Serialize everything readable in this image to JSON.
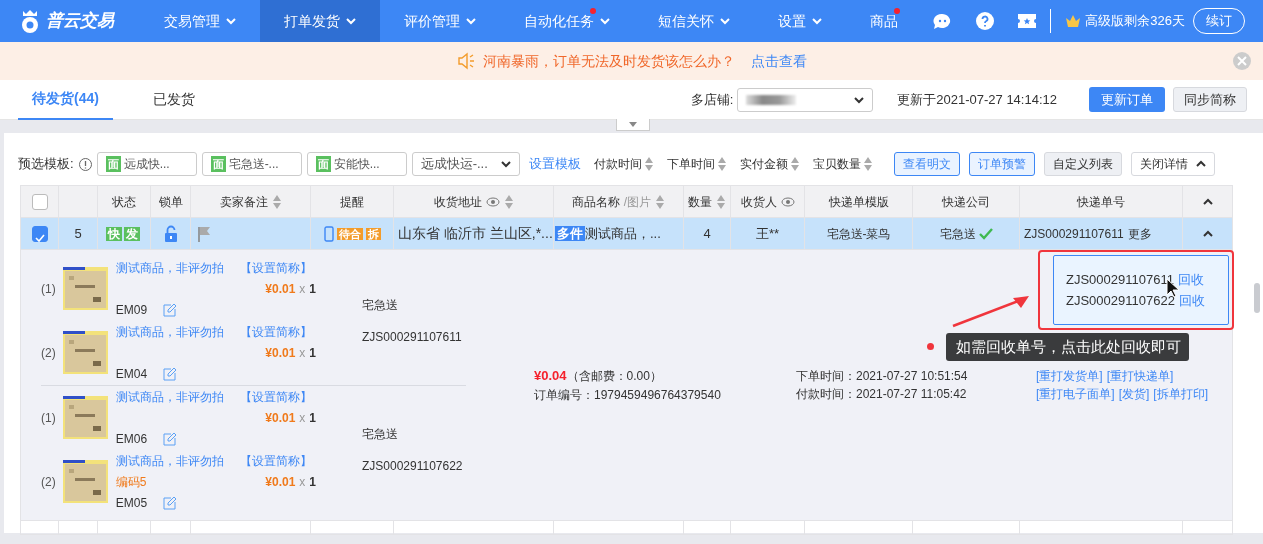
{
  "nav": {
    "logo": "普云交易",
    "menu": [
      {
        "label": "交易管理",
        "selected": false,
        "dropdown": true,
        "dot": false
      },
      {
        "label": "打单发货",
        "selected": true,
        "dropdown": true,
        "dot": false
      },
      {
        "label": "评价管理",
        "selected": false,
        "dropdown": true,
        "dot": false
      },
      {
        "label": "自动化任务",
        "selected": false,
        "dropdown": true,
        "dot": true
      },
      {
        "label": "短信关怀",
        "selected": false,
        "dropdown": true,
        "dot": false
      },
      {
        "label": "设置",
        "selected": false,
        "dropdown": true,
        "dot": false
      },
      {
        "label": "商品",
        "selected": false,
        "dropdown": false,
        "dot": true
      }
    ],
    "plan": "高级版剩余326天",
    "renew": "续订"
  },
  "notice": {
    "text": "河南暴雨，订单无法及时发货该怎么办？",
    "link": "点击查看"
  },
  "tabs": [
    {
      "label": "待发货(44)",
      "selected": true
    },
    {
      "label": "已发货",
      "selected": false
    }
  ],
  "store_label": "多店铺:",
  "updated": "更新于2021-07-27 14:14:12",
  "top_buttons": [
    {
      "label": "更新订单",
      "kind": "primary"
    },
    {
      "label": "同步简称",
      "kind": "plain"
    }
  ],
  "toolbar": {
    "label": "预选模板:",
    "templates": [
      {
        "tag": "面",
        "label": "远成快..."
      },
      {
        "tag": "面",
        "label": "宅急送-..."
      },
      {
        "tag": "面",
        "label": "安能快..."
      }
    ],
    "template_select": "远成快运-...",
    "settings_link": "设置模板",
    "sorts": [
      "付款时间",
      "下单时间",
      "实付金额",
      "宝贝数量"
    ],
    "buttons": [
      {
        "label": "查看明文",
        "kind": "outline"
      },
      {
        "label": "订单预警",
        "kind": "outline"
      },
      {
        "label": "自定义列表",
        "kind": "plain"
      },
      {
        "label": "关闭详情",
        "kind": "toggle"
      }
    ]
  },
  "table": {
    "header_checked": false,
    "columns": [
      {
        "label": "状态",
        "sortable": false,
        "eye": false
      },
      {
        "label": "锁单",
        "sortable": false,
        "eye": false
      },
      {
        "label": "卖家备注",
        "sortable": true,
        "eye": false
      },
      {
        "label": "提醒",
        "sortable": false,
        "eye": false
      },
      {
        "label": "收货地址",
        "sortable": true,
        "eye": true
      },
      {
        "label": "商品名称",
        "sub": "/图片",
        "sortable": true,
        "eye": false
      },
      {
        "label": "数量",
        "sortable": true,
        "eye": false
      },
      {
        "label": "收货人",
        "sortable": false,
        "eye": true
      },
      {
        "label": "快递单模版",
        "sortable": false,
        "eye": false
      },
      {
        "label": "快递公司",
        "sortable": false,
        "eye": false
      },
      {
        "label": "快递单号",
        "sortable": false,
        "eye": false
      }
    ],
    "rows": [
      {
        "selected": true,
        "index": "5",
        "status_tags": [
          "快",
          "发"
        ],
        "locked": false,
        "reminders": [
          "待合",
          "拆"
        ],
        "address": "山东省 临沂市 兰山区,*...",
        "goods_tag": "多件",
        "goods": "测试商品，...",
        "qty": "4",
        "receiver": "王**",
        "template": "宅急送-菜鸟",
        "company": "宅急送",
        "company_verified": true,
        "tracking": "ZJS000291107611",
        "more": "更多",
        "expanded": true
      }
    ]
  },
  "detail": {
    "packages": [
      {
        "items": [
          {
            "index": "(1)",
            "name": "测试商品，非评勿拍",
            "alias_link": "【设置简称】",
            "price": "¥0.01",
            "times": "x",
            "qty": "1",
            "code": "EM09"
          },
          {
            "index": "(2)",
            "name": "测试商品，非评勿拍",
            "alias_link": "【设置简称】",
            "price": "¥0.01",
            "times": "x",
            "qty": "1",
            "code": "EM04"
          }
        ],
        "carrier": "宅急送",
        "tracking": "ZJS000291107611"
      },
      {
        "items": [
          {
            "index": "(1)",
            "name": "测试商品，非评勿拍",
            "alias_link": "【设置简称】",
            "price": "¥0.01",
            "times": "x",
            "qty": "1",
            "code": "EM06"
          },
          {
            "index": "(2)",
            "name": "测试商品，非评勿拍",
            "alias_link": "【设置简称】",
            "extra": "编码5",
            "price": "¥0.01",
            "times": "x",
            "qty": "1",
            "code": "EM05"
          }
        ],
        "carrier": "宅急送",
        "tracking": "ZJS000291107622"
      }
    ],
    "total": "¥0.04",
    "shipping": "（含邮费：0.00）",
    "order_no": "订单编号：1979459496764379540",
    "order_time": "下单时间：2021-07-27 10:51:54",
    "pay_time": "付款时间：2021-07-27 11:05:42",
    "actions": [
      [
        "[重打发货单]",
        "[重打快递单]"
      ],
      [
        "[重打电子面单]",
        "[发货]",
        "[拆单打印]"
      ]
    ]
  },
  "popover": {
    "entries": [
      {
        "tracking": "ZJS000291107611",
        "action": "回收"
      },
      {
        "tracking": "ZJS000291107622",
        "action": "回收"
      }
    ]
  },
  "annotation": {
    "text": "如需回收单号，点击此处回收即可"
  }
}
